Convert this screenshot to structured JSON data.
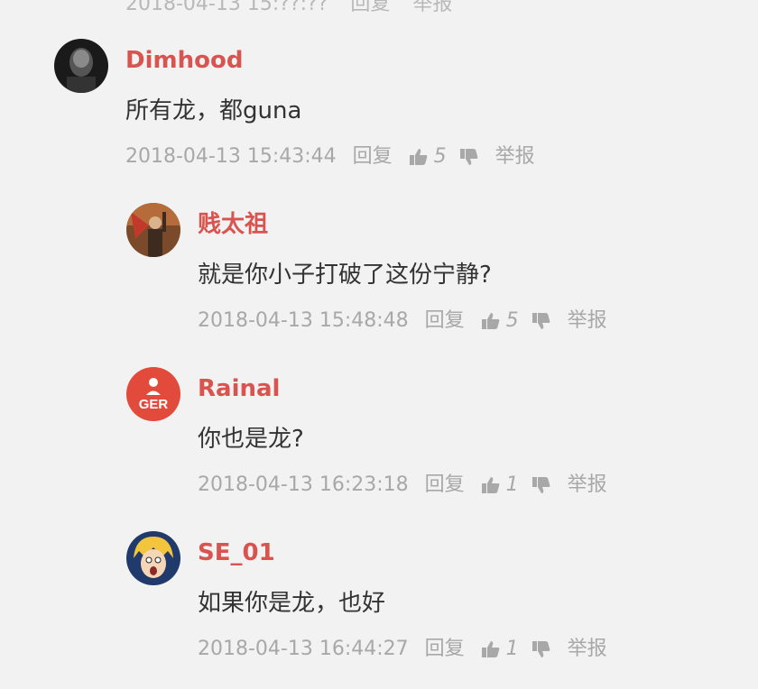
{
  "previous": {
    "time": "2018-04-13 15:??:??",
    "reply": "回复",
    "report": "举报"
  },
  "labels": {
    "reply": "回复",
    "report": "举报"
  },
  "comments": [
    {
      "username": "Dimhood",
      "content": "所有龙，都guna",
      "time": "2018-04-13 15:43:44",
      "likes": "5"
    },
    {
      "username": "贱太祖",
      "content": "就是你小子打破了这份宁静?",
      "time": "2018-04-13 15:48:48",
      "likes": "5"
    },
    {
      "username": "Rainal",
      "content": "你也是龙?",
      "time": "2018-04-13 16:23:18",
      "likes": "1",
      "avatar_text": "GER"
    },
    {
      "username": "SE_01",
      "content": "如果你是龙，也好",
      "time": "2018-04-13 16:44:27",
      "likes": "1"
    }
  ],
  "colors": {
    "background": "#f2f2f2",
    "username": "#d9534f",
    "meta": "#a8a8a8",
    "content": "#333333",
    "avatar_red": "#e24a3b"
  }
}
